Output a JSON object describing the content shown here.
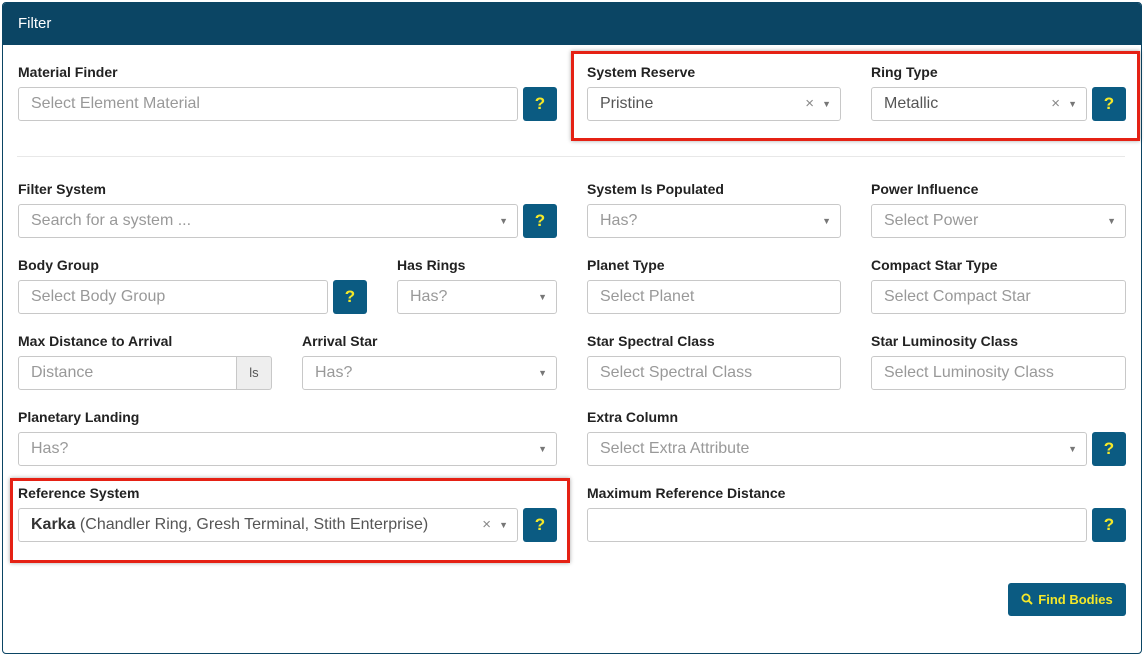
{
  "panel": {
    "title": "Filter"
  },
  "material_finder": {
    "label": "Material Finder",
    "placeholder": "Select Element Material"
  },
  "system_reserve": {
    "label": "System Reserve",
    "value": "Pristine"
  },
  "ring_type": {
    "label": "Ring Type",
    "value": "Metallic"
  },
  "filter_system": {
    "label": "Filter System",
    "placeholder": "Search for a system ..."
  },
  "system_is_populated": {
    "label": "System Is Populated",
    "placeholder": "Has?"
  },
  "power_influence": {
    "label": "Power Influence",
    "placeholder": "Select Power"
  },
  "body_group": {
    "label": "Body Group",
    "placeholder": "Select Body Group"
  },
  "has_rings": {
    "label": "Has Rings",
    "placeholder": "Has?"
  },
  "planet_type": {
    "label": "Planet Type",
    "placeholder": "Select Planet"
  },
  "compact_star_type": {
    "label": "Compact Star Type",
    "placeholder": "Select Compact Star"
  },
  "max_distance": {
    "label": "Max Distance to Arrival",
    "placeholder": "Distance",
    "unit": "ls"
  },
  "arrival_star": {
    "label": "Arrival Star",
    "placeholder": "Has?"
  },
  "star_spectral_class": {
    "label": "Star Spectral Class",
    "placeholder": "Select Spectral Class"
  },
  "star_luminosity_class": {
    "label": "Star Luminosity Class",
    "placeholder": "Select Luminosity Class"
  },
  "planetary_landing": {
    "label": "Planetary Landing",
    "placeholder": "Has?"
  },
  "extra_column": {
    "label": "Extra Column",
    "placeholder": "Select Extra Attribute"
  },
  "reference_system": {
    "label": "Reference System",
    "value_name": "Karka",
    "value_detail": " (Chandler Ring, Gresh Terminal, Stith Enterprise)"
  },
  "max_reference_distance": {
    "label": "Maximum Reference Distance",
    "value": ""
  },
  "symbols": {
    "help": "?",
    "clear": "×",
    "arrow": "▼"
  },
  "find_button": {
    "label": "Find Bodies"
  },
  "colors": {
    "header": "#0b4564",
    "button": "#0b5b82",
    "button_text": "#f5e829",
    "highlight": "#e52114"
  }
}
